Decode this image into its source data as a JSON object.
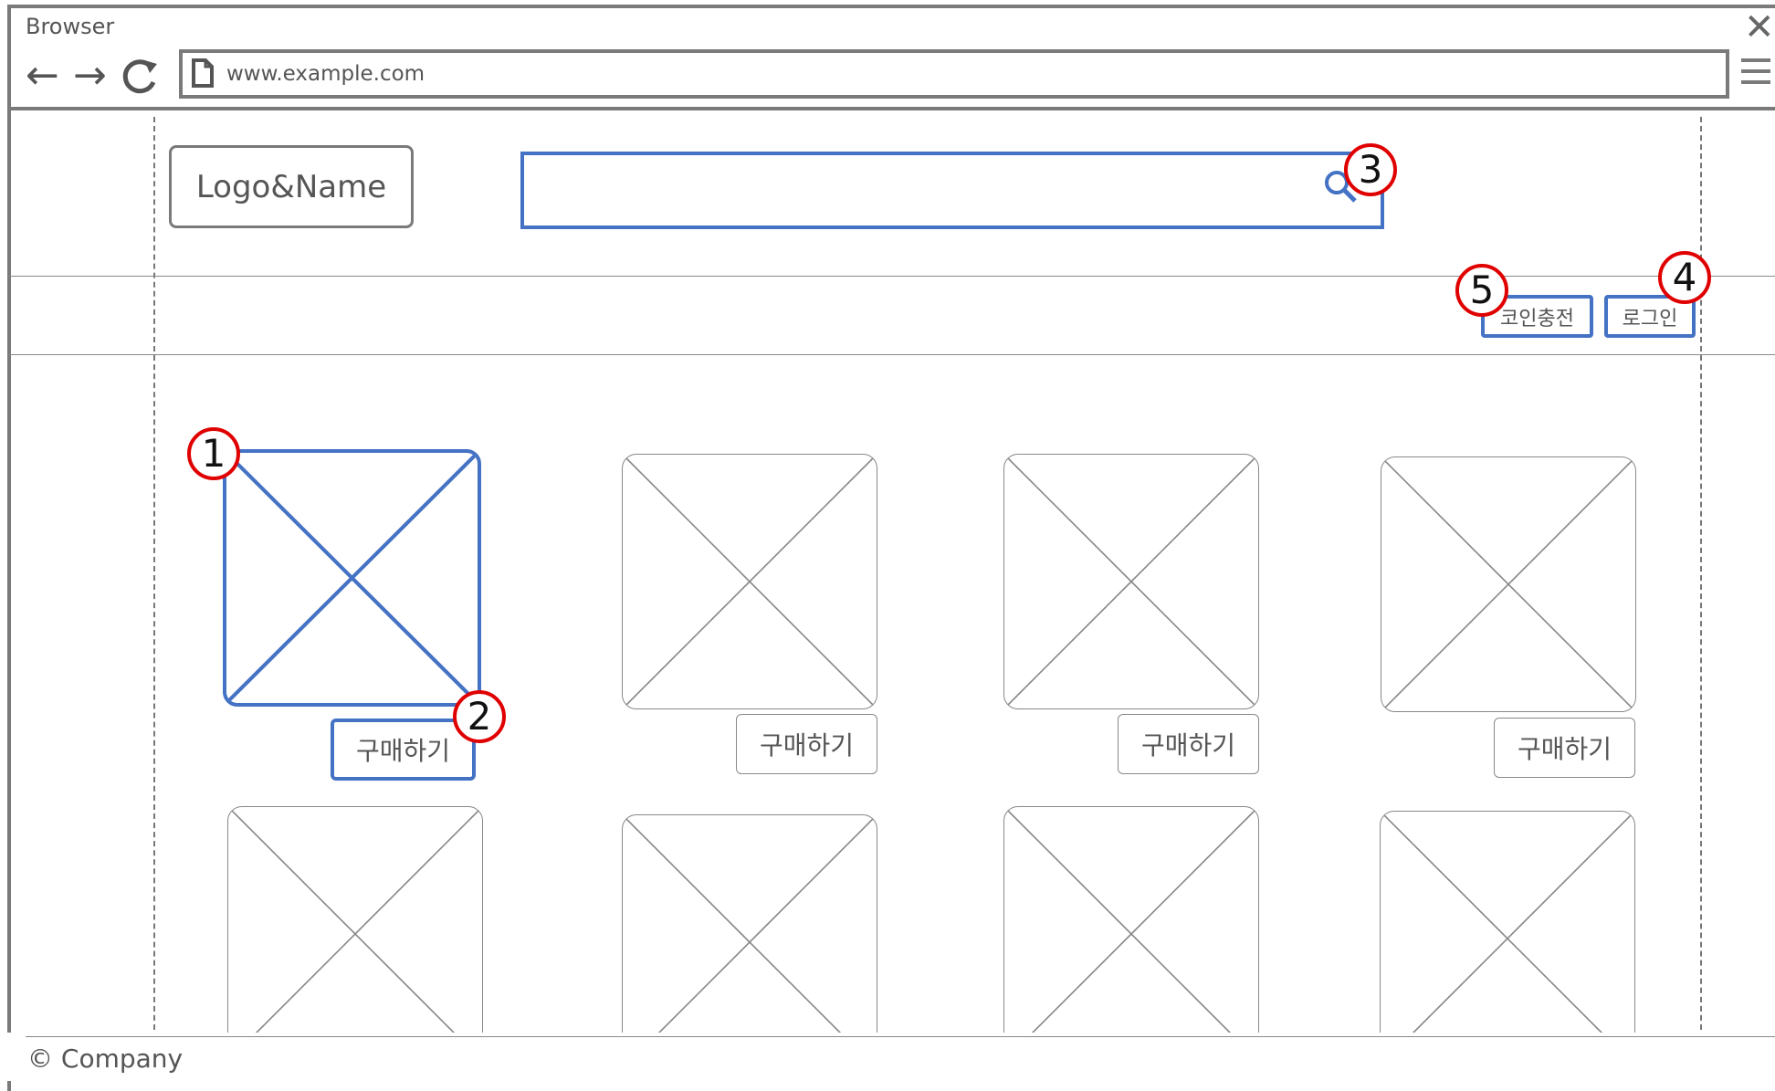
{
  "browser": {
    "title": "Browser",
    "url": "www.example.com",
    "nav": {
      "back": "←",
      "forward": "→",
      "reload": "C"
    },
    "close": "✕"
  },
  "header": {
    "logo": "Logo&Name",
    "search_placeholder": ""
  },
  "actions": {
    "coin_charge": "코인충전",
    "login": "로그인"
  },
  "products": {
    "buy_label": "구매하기",
    "items": [
      {
        "buy": "구매하기"
      },
      {
        "buy": "구매하기"
      },
      {
        "buy": "구매하기"
      },
      {
        "buy": "구매하기"
      }
    ]
  },
  "markers": [
    "1",
    "2",
    "3",
    "4",
    "5"
  ],
  "footer": {
    "copyright": "© Company"
  },
  "colors": {
    "accent": "#4472c4",
    "marker": "#e00000",
    "frame": "#7a7a7a"
  }
}
